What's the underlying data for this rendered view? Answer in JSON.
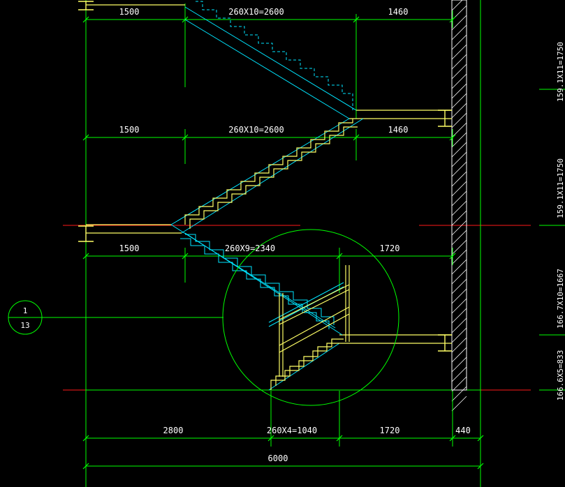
{
  "colors": {
    "background": "#000000",
    "dimension_line": "#00ff00",
    "stair_cyan": "#00e5ff",
    "stair_yellow": "#ffff66",
    "axis_red": "#ff1a1a",
    "wall_hatch": "#ffffff",
    "text": "#ffffff"
  },
  "dimensions": {
    "row1": {
      "landing": "1500",
      "run": "260X10=2600",
      "top_landing": "1460"
    },
    "row2": {
      "landing": "1500",
      "run": "260X10=2600",
      "top_landing": "1460"
    },
    "row3": {
      "landing": "1500",
      "run": "260X9=2340",
      "top_landing": "1720"
    },
    "bottom_row": {
      "seg1": "2800",
      "seg2": "260X4=1040",
      "seg3": "1720",
      "seg4": "440"
    },
    "overall": "6000"
  },
  "vertical_dimensions": {
    "flight1": "159.1X11=1750",
    "flight2": "159.1X11=1750",
    "flight3": "166.7X10=1667",
    "flight4": "166.6X5=833"
  },
  "detail_callout": {
    "number": "1",
    "sheet": "13"
  }
}
